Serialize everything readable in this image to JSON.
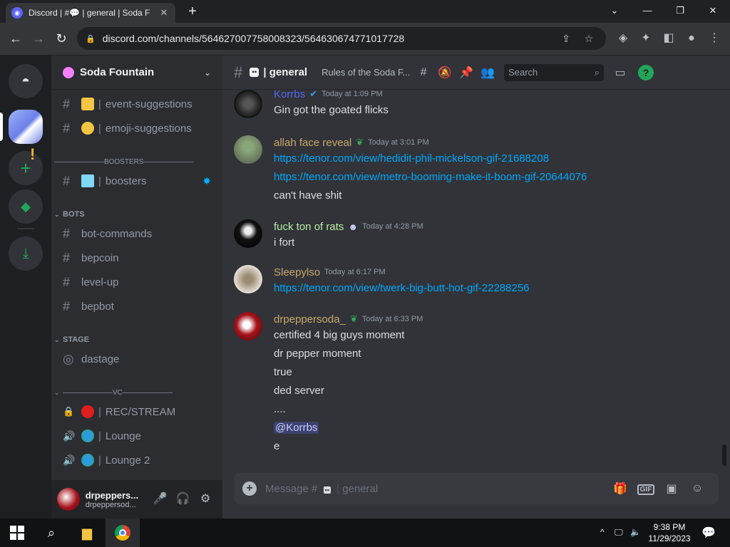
{
  "browser": {
    "tab_title": "Discord | #💬 | general | Soda F",
    "url": "discord.com/channels/564627007758008323/564630674771017728"
  },
  "server": {
    "name": "Soda Fountain",
    "channels": [
      {
        "name": "event-suggestions"
      },
      {
        "name": "emoji-suggestions"
      }
    ],
    "boosters_divider": "———————BOOSTERS———————",
    "boosters_channel": "boosters",
    "bots_category": "BOTS",
    "bots_channels": [
      "bot-commands",
      "bepcoin",
      "level-up",
      "bepbot"
    ],
    "stage_category": "STAGE",
    "stage_channel": "dastage",
    "vc_divider": "———————VC———————",
    "vc_channels": [
      "REC/STREAM",
      "Lounge",
      "Lounge 2"
    ]
  },
  "user": {
    "display_name": "drpeppers...",
    "username": "drpeppersod..."
  },
  "channel_header": {
    "name": "general",
    "topic": "Rules of the Soda F...",
    "search_placeholder": "Search"
  },
  "messages": [
    {
      "author": "Korrbs",
      "color": "#5865f2",
      "timestamp": "Today at 1:09 PM",
      "lines": [
        "Gin got the goated flicks"
      ]
    },
    {
      "author": "allah face reveal",
      "color": "#c9a86a",
      "timestamp": "Today at 3:01 PM",
      "lines": [
        "https://tenor.com/view/hedidit-phil-mickelson-gif-21688208",
        "https://tenor.com/view/metro-booming-make-it-boom-gif-20644076",
        "can't have shit"
      ]
    },
    {
      "author": "fuck ton of rats",
      "color": "#b6f0a0",
      "timestamp": "Today at 4:28 PM",
      "lines": [
        "i fort"
      ]
    },
    {
      "author": "Sleepylso",
      "color": "#c9a86a",
      "timestamp": "Today at 6:17 PM",
      "lines": [
        "https://tenor.com/view/twerk-big-butt-hot-gif-22288256"
      ]
    },
    {
      "author": "drpeppersoda_",
      "color": "#c9a86a",
      "timestamp": "Today at 6:33 PM",
      "lines": [
        "certified 4 big guys moment",
        "dr pepper moment",
        "true",
        "ded server",
        "....",
        "@Korrbs",
        "e"
      ]
    }
  ],
  "composer": {
    "placeholder": "Message #",
    "placeholder_channel": "general"
  },
  "taskbar": {
    "time": "9:38 PM",
    "date": "11/29/2023"
  }
}
